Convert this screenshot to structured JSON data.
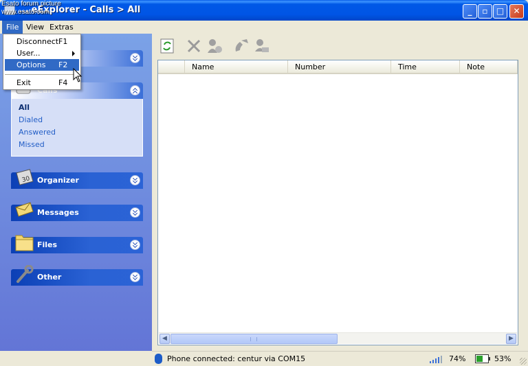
{
  "window": {
    "title": "… eExplorer  -  Calls > All",
    "watermark_line1": "Esato forum picture",
    "watermark_line2": "www.esato.com"
  },
  "menubar": {
    "file": "File",
    "view": "View",
    "extras": "Extras"
  },
  "file_menu": {
    "disconnect": {
      "label": "Disconnect",
      "key": "F1"
    },
    "user": {
      "label": "User..."
    },
    "options": {
      "label": "Options",
      "key": "F2"
    },
    "exit": {
      "label": "Exit",
      "key": "F4"
    }
  },
  "sidebar": {
    "calls": {
      "label": "Calls",
      "items": [
        "All",
        "Dialed",
        "Answered",
        "Missed"
      ]
    },
    "organizer": "Organizer",
    "messages": "Messages",
    "files": "Files",
    "other": "Other"
  },
  "list": {
    "columns": [
      "Name",
      "Number",
      "Time",
      "Note"
    ]
  },
  "status": {
    "connection": "Phone connected: centur via COM15",
    "signal": "74%",
    "battery": "53%"
  }
}
